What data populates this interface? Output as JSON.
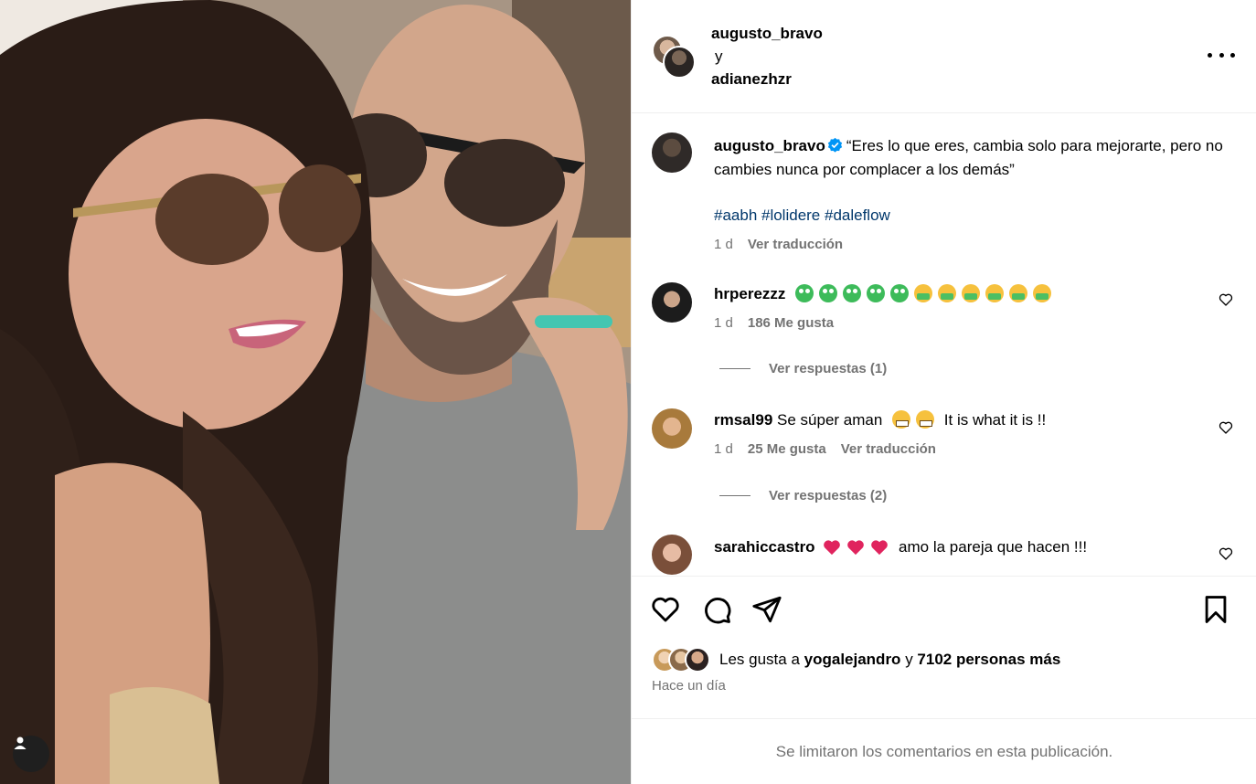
{
  "post": {
    "author": "augusto_bravo",
    "conjunction": "y",
    "collaborator": "adianezhzr"
  },
  "caption": {
    "username": "augusto_bravo",
    "text": "“Eres lo que eres, cambia solo para mejorarte, pero no cambies nunca por complacer a los demás”",
    "hashtags": "#aabh #lolidere #daleflow",
    "time": "1 d",
    "translate": "Ver traducción"
  },
  "comments": [
    {
      "username": "hrperezzz",
      "time": "1 d",
      "likes": "186 Me gusta",
      "replies": "Ver respuestas (1)"
    },
    {
      "username": "rmsal99",
      "text_a": "Se súper aman",
      "text_b": "It is what it is !!",
      "time": "1 d",
      "likes": "25 Me gusta",
      "translate": "Ver traducción",
      "replies": "Ver respuestas (2)"
    },
    {
      "username": "sarahiccastro",
      "text": "amo la pareja que hacen !!!"
    }
  ],
  "likes_line": {
    "prefix": "Les gusta a",
    "user": "yogalejandro",
    "middle": "y",
    "count": "7102 personas más"
  },
  "posted": "Hace un día",
  "footer": "Se limitaron los comentarios en esta publicación.",
  "colors": {
    "link": "#00376b",
    "meta": "#737373",
    "verified": "#0095f6",
    "heart": "#e0245e"
  },
  "icons": [
    "heart-icon",
    "comment-icon",
    "share-icon",
    "bookmark-icon",
    "more-icon",
    "user-tag-icon",
    "verified-badge-icon"
  ]
}
